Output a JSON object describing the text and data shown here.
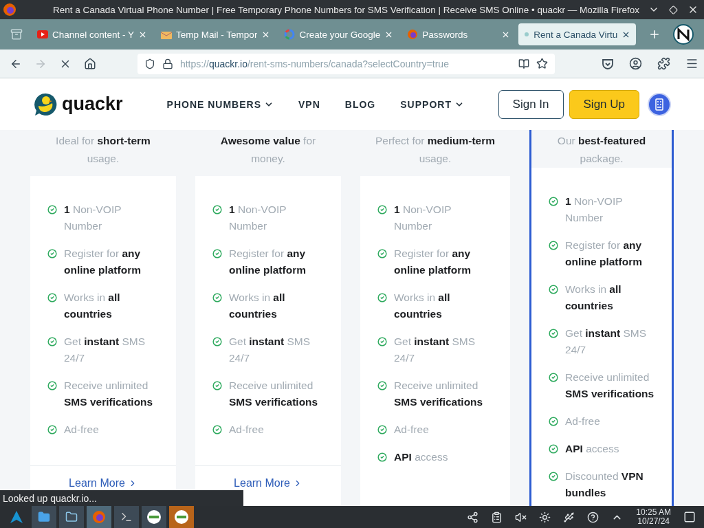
{
  "window": {
    "title": "Rent a Canada Virtual Phone Number | Free Temporary Phone Numbers for SMS Verification | Receive SMS Online • quackr — Mozilla Firefox"
  },
  "tabs": [
    {
      "title": "Channel content - Y",
      "selected": false
    },
    {
      "title": "Temp Mail - Tempor",
      "selected": false
    },
    {
      "title": "Create your Google",
      "selected": false
    },
    {
      "title": "Passwords",
      "selected": false
    },
    {
      "title": "Rent a Canada Virtu",
      "selected": true
    }
  ],
  "nav_buttons": [
    {
      "kind": "back",
      "disabled": false
    },
    {
      "kind": "forward",
      "disabled": true
    },
    {
      "kind": "stop",
      "disabled": false
    },
    {
      "kind": "home",
      "disabled": false
    }
  ],
  "url": {
    "scheme": "https://",
    "host": "quackr.io",
    "path": "/rent-sms-numbers/canada?selectCountry=true"
  },
  "site": {
    "logo": "quackr",
    "menu": [
      {
        "label": "PHONE NUMBERS",
        "dropdown": true
      },
      {
        "label": "VPN",
        "dropdown": false
      },
      {
        "label": "BLOG",
        "dropdown": false
      },
      {
        "label": "SUPPORT",
        "dropdown": true
      }
    ],
    "sign_in": "Sign In",
    "sign_up": "Sign Up"
  },
  "plans": [
    {
      "description": "Ideal for **short-term** usage.",
      "featured": false,
      "features": [
        "**1** Non-VOIP Number",
        "Register for **any online platform**",
        "Works in **all countries**",
        "Get **instant** SMS 24/7",
        "Receive unlimited **SMS verifications**",
        "Ad-free"
      ],
      "link": "Learn More"
    },
    {
      "description": "**Awesome value** for money.",
      "featured": false,
      "features": [
        "**1** Non-VOIP Number",
        "Register for **any online platform**",
        "Works in **all countries**",
        "Get **instant** SMS 24/7",
        "Receive unlimited **SMS verifications**",
        "Ad-free"
      ],
      "link": "Learn More"
    },
    {
      "description": "Perfect for **medium-term** usage.",
      "featured": false,
      "features": [
        "**1** Non-VOIP Number",
        "Register for **any online platform**",
        "Works in **all countries**",
        "Get **instant** SMS 24/7",
        "Receive unlimited **SMS verifications**",
        "Ad-free",
        "**API** access"
      ]
    },
    {
      "description": "Our **best-featured** package.",
      "featured": true,
      "features": [
        "**1** Non-VOIP Number",
        "Register for **any online platform**",
        "Works in **all countries**",
        "Get **instant** SMS 24/7",
        "Receive unlimited **SMS verifications**",
        "Ad-free",
        "**API** access",
        "Discounted **VPN bundles**"
      ]
    }
  ],
  "status_text": "Looked up quackr.io...",
  "clock": {
    "time": "10:25 AM",
    "date": "10/27/24"
  }
}
